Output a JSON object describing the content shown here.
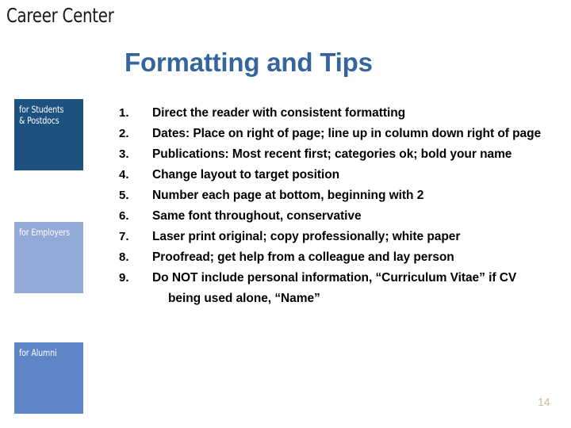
{
  "slide": {
    "logo_text": "Career Center",
    "title": "Formatting and Tips",
    "page_number": "14",
    "background_color": "#ffffff",
    "title_color": "#36659C",
    "page_number_color": "#D8B89A"
  },
  "sidebar": {
    "boxes": [
      {
        "label": "for Students\n& Postdocs",
        "color": "#1C5180"
      },
      {
        "label": "for Employers",
        "color": "#93A9D8"
      },
      {
        "label": "for Alumni",
        "color": "#5E85C8"
      }
    ]
  },
  "content": {
    "items": [
      {
        "number": "1.",
        "text": "Direct the reader with consistent formatting"
      },
      {
        "number": "2.",
        "text": "Dates:  Place on right of page; line up in column down right of page"
      },
      {
        "number": "3.",
        "text": "Publications:  Most recent first; categories ok; bold your name"
      },
      {
        "number": "4.",
        "text": "Change layout to target position"
      },
      {
        "number": "5.",
        "text": "Number each page at bottom, beginning with 2"
      },
      {
        "number": "6.",
        "text": "Same font throughout, conservative"
      },
      {
        "number": "7.",
        "text": "Laser print original; copy professionally; white paper"
      },
      {
        "number": "8.",
        "text": "Proofread; get help from a colleague and lay person"
      },
      {
        "number": "9.",
        "text": "Do NOT include personal information, “Curriculum Vitae” if CV"
      },
      {
        "number": "",
        "text": "being used alone, “Name”",
        "continuation": true
      }
    ]
  }
}
